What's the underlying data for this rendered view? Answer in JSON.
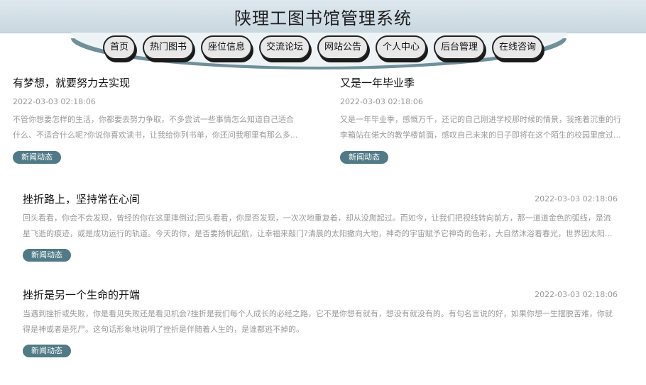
{
  "site": {
    "title": "陕理工图书馆管理系统"
  },
  "nav": [
    {
      "label": "首页"
    },
    {
      "label": "热门图书"
    },
    {
      "label": "座位信息"
    },
    {
      "label": "交流论坛"
    },
    {
      "label": "网站公告"
    },
    {
      "label": "个人中心"
    },
    {
      "label": "后台管理"
    },
    {
      "label": "在线咨询"
    }
  ],
  "posts": [
    {
      "title": "有梦想，就要努力去实现",
      "date": "2022-03-03 02:18:06",
      "excerpt": "不管你想要怎样的生活，你都要去努力争取，不多尝试一些事情怎么知道自己适合什么、不适合什么呢?你说你喜欢读书，让我给你列书单，你还问我哪里有那么多...",
      "tag": "新闻动态"
    },
    {
      "title": "又是一年毕业季",
      "date": "2022-03-03 02:18:06",
      "excerpt": "又是一年毕业季，感慨万千，还记的自己刚进学校那时候的情景，我拖着沉重的行李箱站在偌大的教学楼前面，感叹自己未来的日子即将在这个陌生的校园里度过...",
      "tag": "新闻动态"
    },
    {
      "title": "挫折路上，坚持常在心间",
      "date": "2022-03-03 02:18:06",
      "excerpt": "回头看看，你会不会发现，曾经的你在这里摔倒过;回头看看，你是否发现，一次次地重复着，却从没爬起过。而如今，让我们把视线转向前方，那一道道金色的弧线，是流星飞逝的痕迹，或是成功运行的轨道。今天的你，是否要扬帆起航，让幸福来敲门?清晨的太阳撒向大地，神奇的宇宙赋予它神奇的色彩，大自然沐浴着春光，世界因太阳...",
      "tag": "新闻动态"
    },
    {
      "title": "挫折是另一个生命的开端",
      "date": "2022-03-03 02:18:06",
      "excerpt": "当遇到挫折或失败，你是看见失败还是看见机会?挫折是我们每个人成长的必经之路，它不是你想有就有，想没有就没有的。有句名言说的好，如果你想一生摆脱苦难，你就得是神或者是死尸。这句话形象地说明了挫折是伴随着人生的，是谁都逃不掉的。",
      "tag": "新闻动态"
    }
  ]
}
